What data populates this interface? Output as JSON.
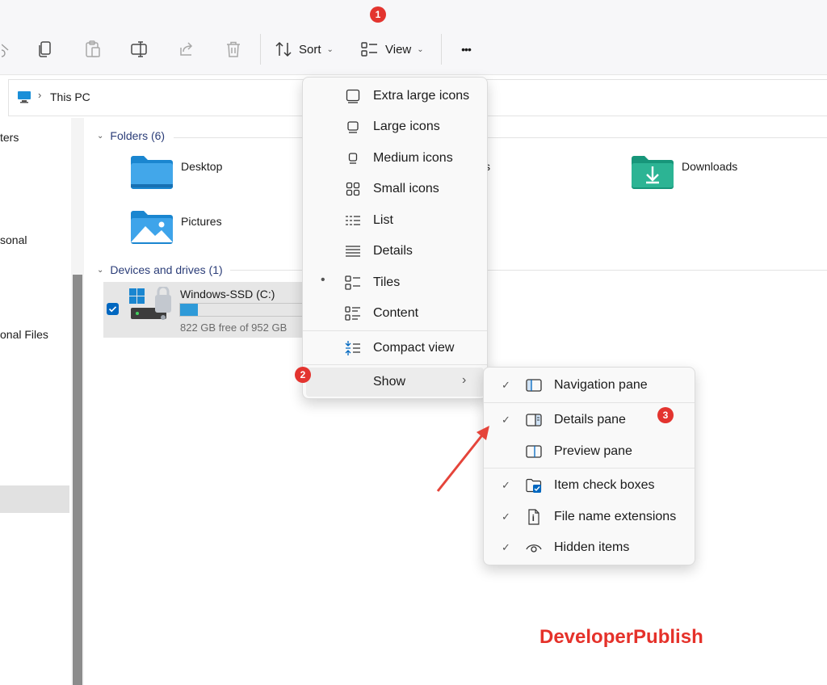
{
  "toolbar": {
    "sort_label": "Sort",
    "view_label": "View",
    "more_label": "•••"
  },
  "address": {
    "location": "This PC"
  },
  "nav": {
    "items": [
      "ters",
      "sonal",
      "onal Files"
    ]
  },
  "content": {
    "folders_header": "Folders (6)",
    "folders": [
      "Desktop",
      "Downloads",
      "Pictures"
    ],
    "folder_partial": "s",
    "drives_header": "Devices and drives (1)",
    "drive": {
      "name": "Windows-SSD (C:)",
      "free_text": "822 GB free of 952 GB",
      "used_fraction": 0.14
    }
  },
  "view_menu": {
    "items": [
      {
        "label": "Extra large icons",
        "icon": "extra-large-icons-icon"
      },
      {
        "label": "Large icons",
        "icon": "large-icons-icon"
      },
      {
        "label": "Medium icons",
        "icon": "medium-icons-icon"
      },
      {
        "label": "Small icons",
        "icon": "small-icons-icon"
      },
      {
        "label": "List",
        "icon": "list-icon"
      },
      {
        "label": "Details",
        "icon": "details-icon"
      },
      {
        "label": "Tiles",
        "icon": "tiles-icon",
        "selected": true
      },
      {
        "label": "Content",
        "icon": "content-icon"
      },
      {
        "label": "Compact view",
        "icon": "compact-view-icon"
      },
      {
        "label": "Show",
        "icon": "chevron-right-icon"
      }
    ]
  },
  "show_menu": {
    "items": [
      {
        "label": "Navigation pane",
        "checked": true,
        "icon": "navigation-pane-icon"
      },
      {
        "label": "Details pane",
        "checked": true,
        "icon": "details-pane-icon"
      },
      {
        "label": "Preview pane",
        "checked": false,
        "icon": "preview-pane-icon"
      },
      {
        "label": "Item check boxes",
        "checked": true,
        "icon": "item-check-boxes-icon"
      },
      {
        "label": "File name extensions",
        "checked": true,
        "icon": "file-name-extensions-icon"
      },
      {
        "label": "Hidden items",
        "checked": true,
        "icon": "hidden-items-icon"
      }
    ]
  },
  "annotations": {
    "badge_1": "1",
    "badge_2": "2",
    "badge_3": "3",
    "watermark": "DeveloperPublish"
  },
  "colors": {
    "accent": "#0067c0",
    "badge": "#e3342f",
    "drive_fill": "#2e9ad8",
    "arrow": "#e5443a"
  }
}
